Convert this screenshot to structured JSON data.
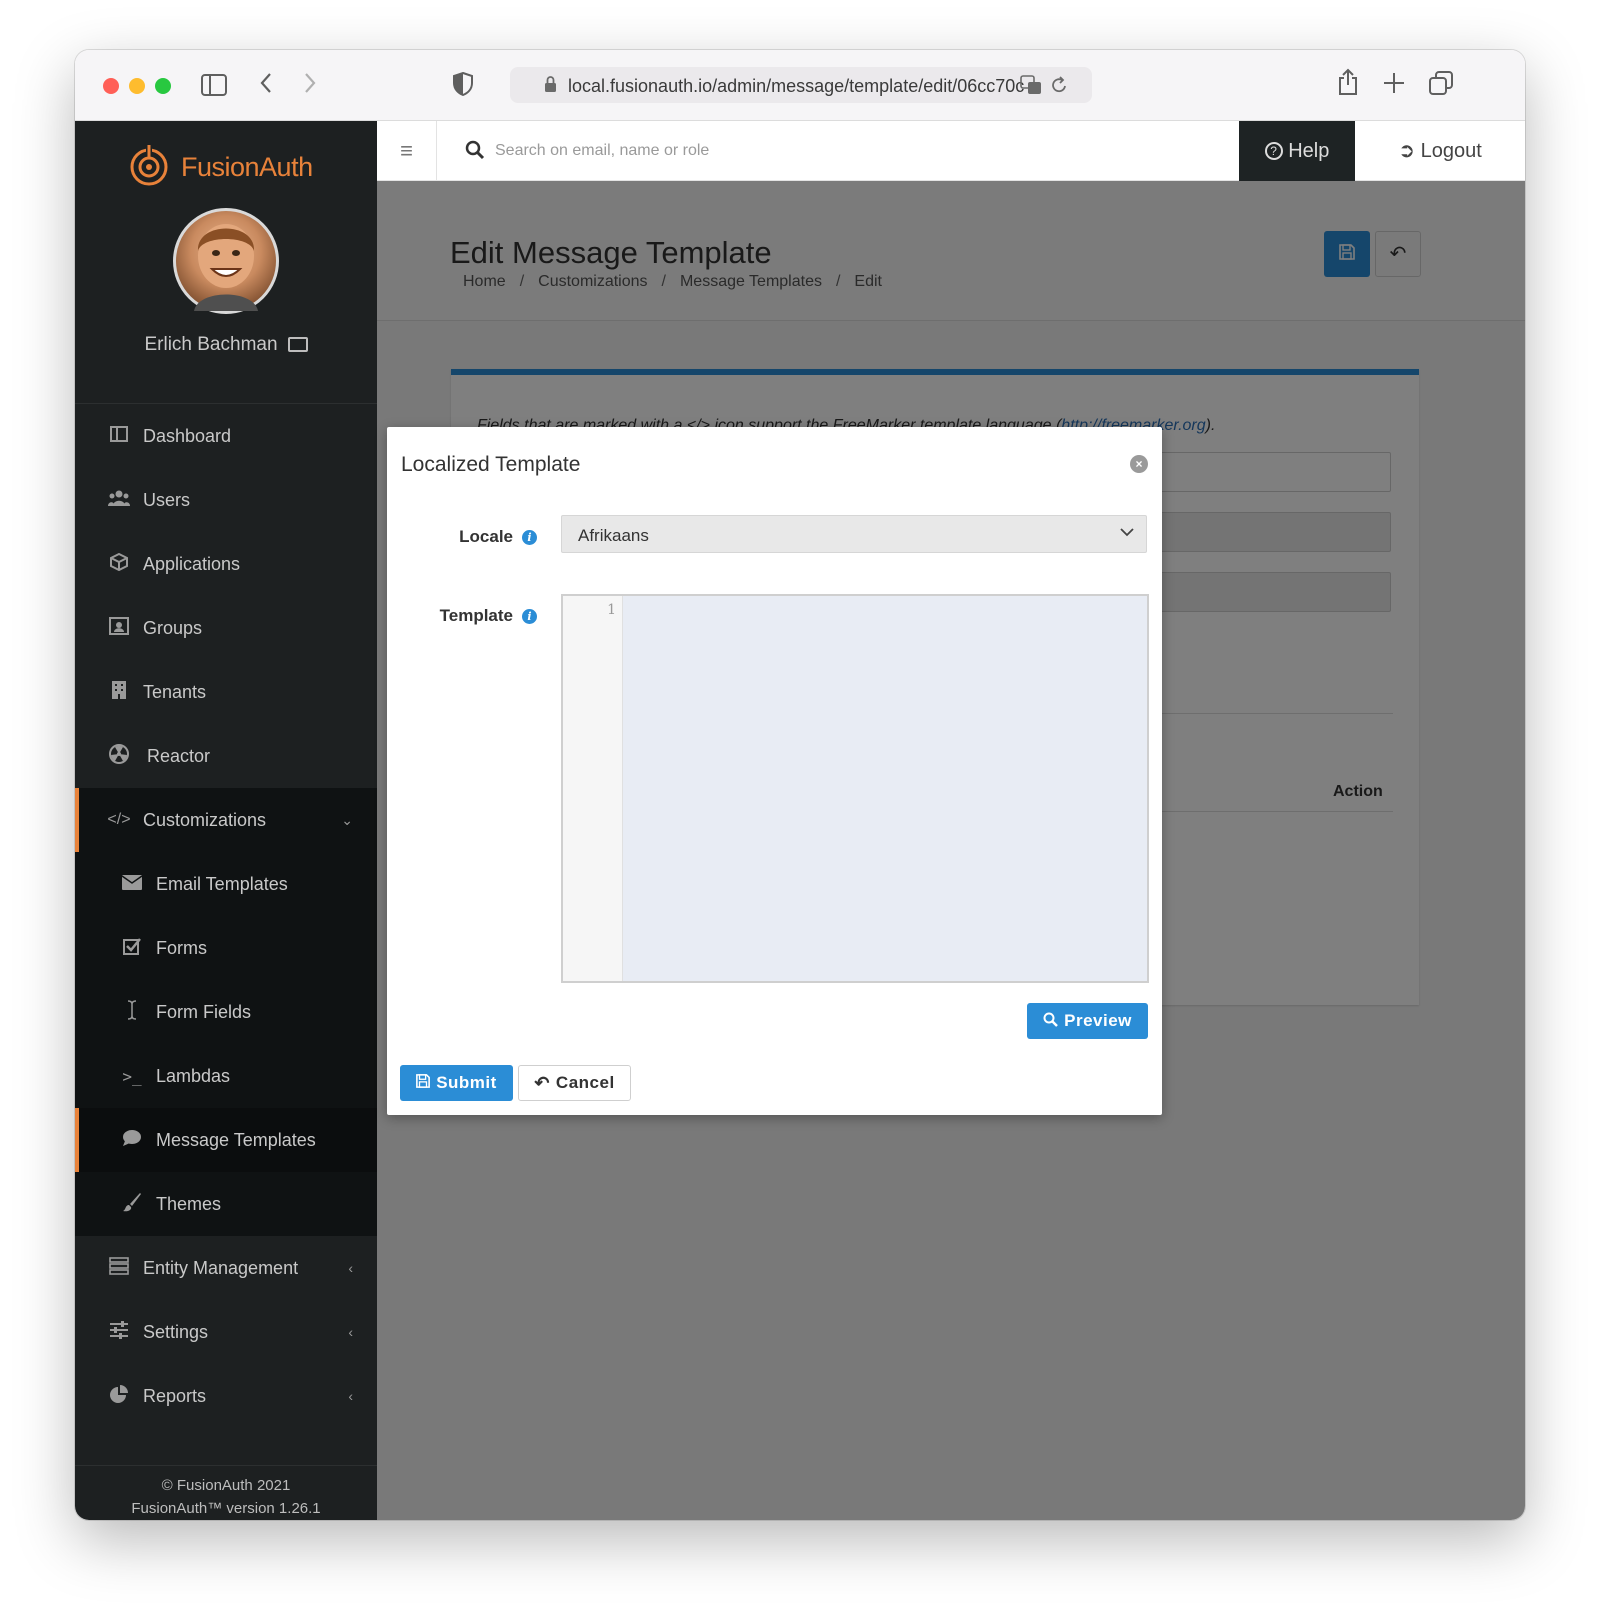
{
  "browser": {
    "url": "local.fusionauth.io/admin/message/template/edit/06cc70c"
  },
  "sidebar": {
    "brand": "FusionAuth",
    "user_name": "Erlich Bachman",
    "items": [
      {
        "label": "Dashboard",
        "icon": "dashboard-icon"
      },
      {
        "label": "Users",
        "icon": "users-icon"
      },
      {
        "label": "Applications",
        "icon": "cube-icon"
      },
      {
        "label": "Groups",
        "icon": "groups-icon"
      },
      {
        "label": "Tenants",
        "icon": "building-icon"
      },
      {
        "label": "Reactor",
        "icon": "reactor-icon"
      },
      {
        "label": "Customizations",
        "icon": "code-icon"
      },
      {
        "label": "Email Templates",
        "icon": "envelope-icon"
      },
      {
        "label": "Forms",
        "icon": "checkbox-icon"
      },
      {
        "label": "Form Fields",
        "icon": "cursor-icon"
      },
      {
        "label": "Lambdas",
        "icon": "terminal-icon"
      },
      {
        "label": "Message Templates",
        "icon": "chat-icon"
      },
      {
        "label": "Themes",
        "icon": "brush-icon"
      },
      {
        "label": "Entity Management",
        "icon": "server-icon"
      },
      {
        "label": "Settings",
        "icon": "sliders-icon"
      },
      {
        "label": "Reports",
        "icon": "pie-chart-icon"
      }
    ],
    "footer_copyright": "© FusionAuth 2021",
    "footer_version": "FusionAuth™ version 1.26.1"
  },
  "topbar": {
    "search_placeholder": "Search on email, name or role",
    "help_label": "Help",
    "logout_label": "Logout"
  },
  "page": {
    "title": "Edit Message Template",
    "breadcrumb": [
      "Home",
      "Customizations",
      "Message Templates",
      "Edit"
    ],
    "note_prefix": "Fields that are marked with a </> icon support the FreeMarker template language (",
    "note_link": "http://freemarker.org",
    "note_suffix": ").",
    "action_header": "Action"
  },
  "modal": {
    "title": "Localized Template",
    "locale_label": "Locale",
    "locale_value": "Afrikaans",
    "template_label": "Template",
    "line_number": "1",
    "preview_label": "Preview",
    "submit_label": "Submit",
    "cancel_label": "Cancel"
  },
  "colors": {
    "accent": "#2b8dd6",
    "brand": "#e8823a",
    "sidebar": "#1d2021"
  }
}
